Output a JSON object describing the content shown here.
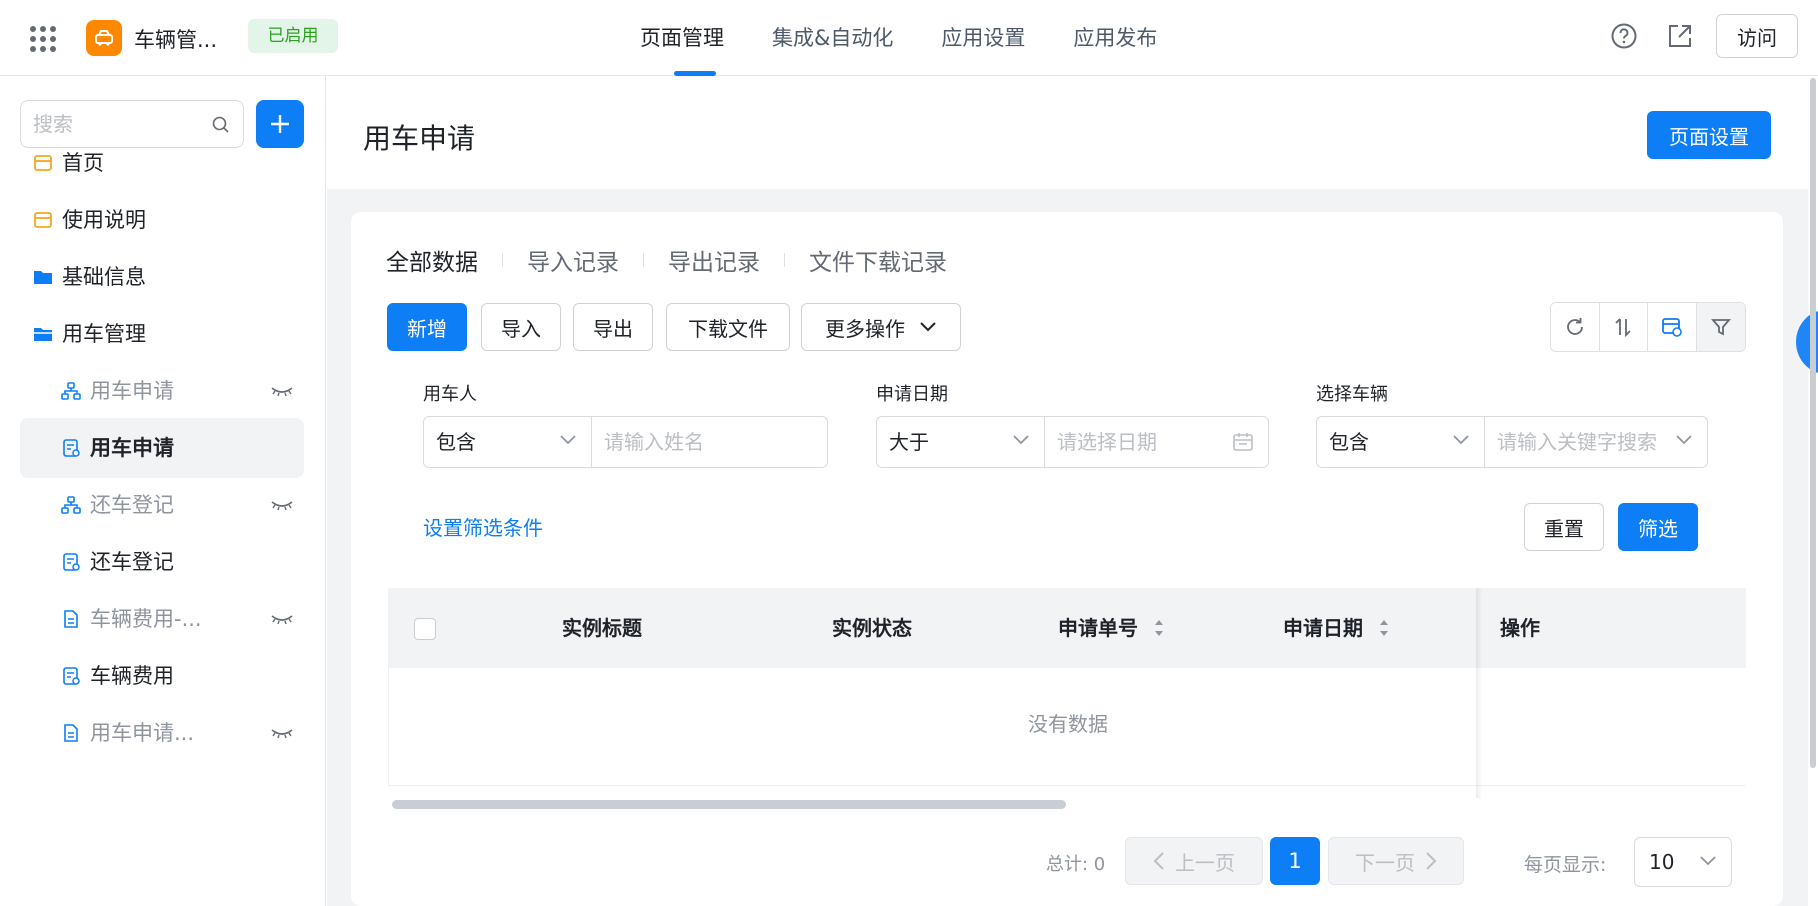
{
  "header": {
    "app_name": "车辆管...",
    "status": "已启用",
    "nav_tabs": [
      "页面管理",
      "集成&自动化",
      "应用设置",
      "应用发布"
    ],
    "visit_label": "访问"
  },
  "sidebar": {
    "search_placeholder": "搜索",
    "items": [
      {
        "label": "首页",
        "icon": "page-icon"
      },
      {
        "label": "使用说明",
        "icon": "page-icon"
      },
      {
        "label": "基础信息",
        "icon": "folder-icon"
      },
      {
        "label": "用车管理",
        "icon": "folder-open-icon"
      },
      {
        "label": "用车申请",
        "icon": "flow-icon",
        "hidden": true
      },
      {
        "label": "用车申请",
        "icon": "form-icon",
        "active": true
      },
      {
        "label": "还车登记",
        "icon": "flow-icon",
        "hidden": true
      },
      {
        "label": "还车登记",
        "icon": "form-icon"
      },
      {
        "label": "车辆费用-...",
        "icon": "doc-icon",
        "hidden": true
      },
      {
        "label": "车辆费用",
        "icon": "form-icon"
      },
      {
        "label": "用车申请...",
        "icon": "doc-icon",
        "hidden": true
      }
    ]
  },
  "page": {
    "title": "用车申请",
    "settings_label": "页面设置"
  },
  "sub_tabs": [
    "全部数据",
    "导入记录",
    "导出记录",
    "文件下载记录"
  ],
  "actions": {
    "add": "新增",
    "import": "导入",
    "export": "导出",
    "download": "下载文件",
    "more": "更多操作"
  },
  "filters": [
    {
      "label": "用车人",
      "operator": "包含",
      "placeholder": "请输入姓名"
    },
    {
      "label": "申请日期",
      "operator": "大于",
      "placeholder": "请选择日期"
    },
    {
      "label": "选择车辆",
      "operator": "包含",
      "placeholder": "请输入关键字搜索"
    }
  ],
  "filter_actions": {
    "set_conditions": "设置筛选条件",
    "reset": "重置",
    "apply": "筛选"
  },
  "table": {
    "columns": [
      "实例标题",
      "实例状态",
      "申请单号",
      "申请日期",
      "操作"
    ],
    "empty_text": "没有数据"
  },
  "pagination": {
    "total": "总计: 0",
    "prev": "上一页",
    "next": "下一页",
    "current_page": "1",
    "per_page_label": "每页显示:",
    "per_page_value": "10"
  },
  "colors": {
    "primary": "#0d7ef6",
    "app_logo": "#ff8800",
    "status_green": "#2ea121"
  }
}
